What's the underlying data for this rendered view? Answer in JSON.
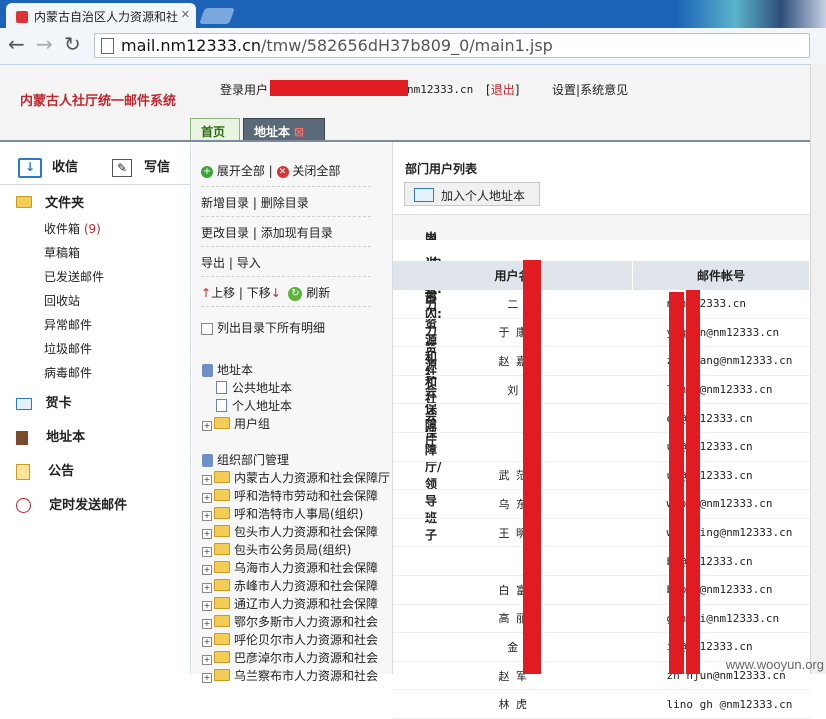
{
  "browser": {
    "tab_title": "内蒙古自治区人力资源和社",
    "url_host": "mail.nm12333.cn",
    "url_path": "/tmw/582656dH37b809_0/main1.jsp"
  },
  "header": {
    "logo": "内蒙古人社厅统一邮件系统",
    "login_label": "登录用户",
    "login_email_suffix": "nm12333.cn",
    "logout": "退出",
    "settings": "设置",
    "feedback": "系统意见",
    "tabs": [
      "首页",
      "地址本"
    ]
  },
  "sidebar": {
    "receive": "收信",
    "compose": "写信",
    "folders_title": "文件夹",
    "folders": [
      {
        "label": "收件箱",
        "count": "(9)"
      },
      {
        "label": "草稿箱"
      },
      {
        "label": "已发送邮件"
      },
      {
        "label": "回收站"
      },
      {
        "label": "异常邮件"
      },
      {
        "label": "垃圾邮件"
      },
      {
        "label": "病毒邮件"
      }
    ],
    "card": "贺卡",
    "addressbook": "地址本",
    "notice": "公告",
    "scheduled": "定时发送邮件"
  },
  "middle": {
    "expand_all": "展开全部",
    "close_all": "关闭全部",
    "new_dir": "新增目录",
    "delete_dir": "删除目录",
    "change_dir": "更改目录",
    "add_existing": "添加现有目录",
    "export": "导出",
    "import": "导入",
    "move_up": "上移",
    "move_down": "下移",
    "refresh": "刷新",
    "list_all": "列出目录下所有明细",
    "tree_addressbook": "地址本",
    "tree_public": "公共地址本",
    "tree_personal": "个人地址本",
    "tree_groups": "用户组",
    "tree_org": "组织部门管理",
    "orgs": [
      "内蒙古人力资源和社会保障厅",
      "呼和浩特市劳动和社会保障",
      "呼和浩特市人事局(组织)",
      "包头市人力资源和社会保障",
      "包头市公务员局(组织)",
      "乌海市人力资源和社会保障",
      "赤峰市人力资源和社会保障",
      "通辽市人力资源和社会保障",
      "鄂尔多斯市人力资源和社会",
      "呼伦贝尔市人力资源和社会",
      "巴彦淖尔市人力资源和社会",
      "乌兰察布市人力资源和社会"
    ]
  },
  "right": {
    "title": "部门用户列表",
    "add_personal": "加入个人地址本",
    "org_label": "当前组织:",
    "org_value": "内蒙古人力资源和社会保障厅",
    "dept_label": "当前部门:",
    "dept_value": "/内蒙古人力资源和社会保障厅/领导班子",
    "col_name": "用户名",
    "col_email": "邮件帐号",
    "users": [
      {
        "name": "    二",
        "email": "        n@nm12333.cn"
      },
      {
        "name": "于  康",
        "email": "y    quan@nm12333.cn"
      },
      {
        "name": "赵  嘉",
        "email": "zh       liang@nm12333.cn"
      },
      {
        "name": "刘   ",
        "email": "l       nyi@nm12333.cn"
      },
      {
        "name": "     ",
        "email": "         ei@nm12333.cn"
      },
      {
        "name": "     ",
        "email": "         un@nm12333.cn"
      },
      {
        "name": "武  茫",
        "email": "         ue@nm12333.cn"
      },
      {
        "name": "乌  东",
        "email": "w     ong@nm12333.cn"
      },
      {
        "name": "王  明",
        "email": "wa      gming@nm12333.cn"
      },
      {
        "name": "     ",
        "email": "       bo@nm12333.cn"
      },
      {
        "name": "白  富",
        "email": "b     bao@nm12333.cn"
      },
      {
        "name": "高  丽",
        "email": "g      ngli@nm12333.cn"
      },
      {
        "name": "  金 ",
        "email": "        in@nm12333.cn"
      },
      {
        "name": "赵  军",
        "email": "zh       njun@nm12333.cn"
      },
      {
        "name": "林  虎",
        "email": "lino   gh   @nm12333.cn"
      }
    ]
  },
  "watermark": "www.wooyun.org"
}
